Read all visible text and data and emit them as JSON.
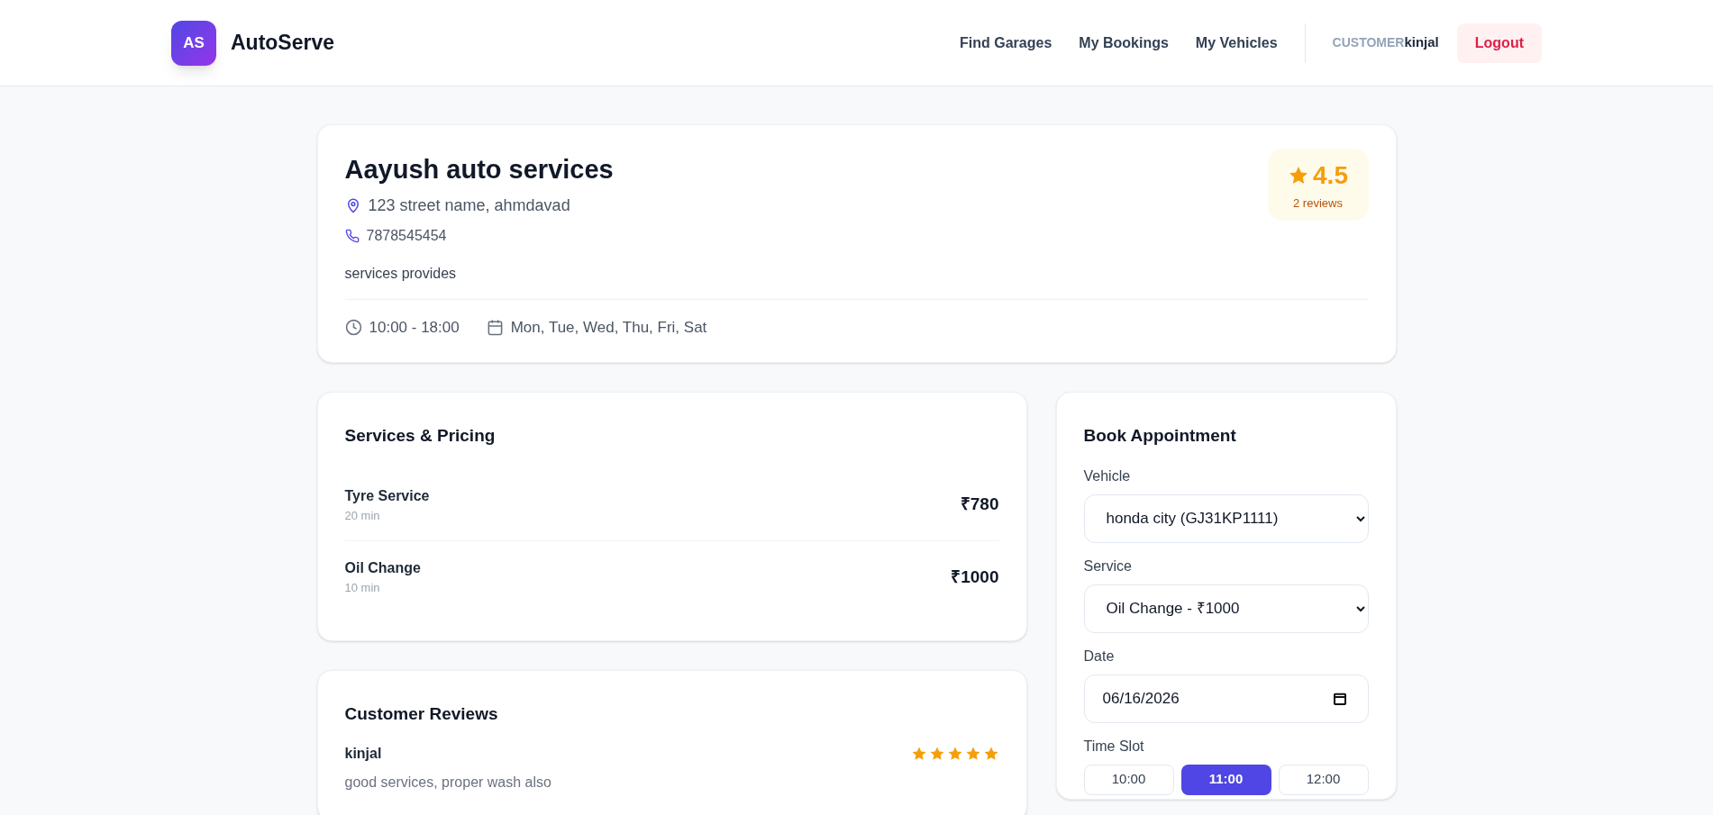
{
  "header": {
    "logo_initials": "AS",
    "brand": "AutoServe",
    "nav": [
      {
        "label": "Find Garages"
      },
      {
        "label": "My Bookings"
      },
      {
        "label": "My Vehicles"
      }
    ],
    "role": "CUSTOMER",
    "user": "kinjal",
    "logout": "Logout"
  },
  "garage": {
    "name": "Aayush auto services",
    "address": "123 street name, ahmdavad",
    "phone": "7878545454",
    "description": "services provides",
    "hours": "10:00 - 18:00",
    "days": "Mon, Tue, Wed, Thu, Fri, Sat",
    "rating": "4.5",
    "reviews_count": "2 reviews"
  },
  "services": {
    "title": "Services & Pricing",
    "items": [
      {
        "name": "Tyre Service",
        "duration": "20 min",
        "price": "₹780"
      },
      {
        "name": "Oil Change",
        "duration": "10 min",
        "price": "₹1000"
      }
    ]
  },
  "reviews": {
    "title": "Customer Reviews",
    "items": [
      {
        "author": "kinjal",
        "text": "good services, proper wash also",
        "stars": 5
      }
    ]
  },
  "booking": {
    "title": "Book Appointment",
    "vehicle_label": "Vehicle",
    "vehicle": "honda city (GJ31KP1111)",
    "service_label": "Service",
    "service": "Oil Change - ₹1000",
    "date_label": "Date",
    "date": "06/16/2026",
    "slot_label": "Time Slot",
    "slots": [
      {
        "label": "10:00",
        "selected": false
      },
      {
        "label": "11:00",
        "selected": true
      },
      {
        "label": "12:00",
        "selected": false
      }
    ]
  }
}
